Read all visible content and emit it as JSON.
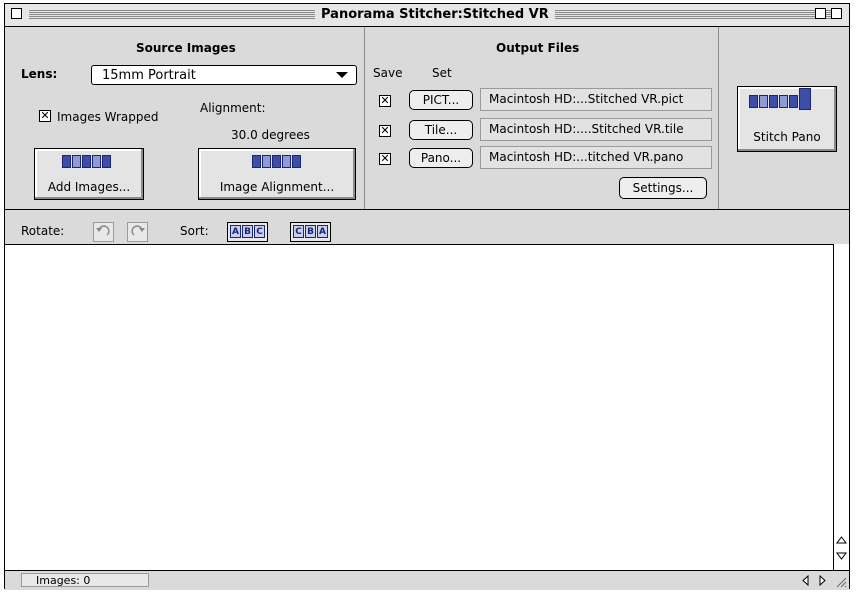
{
  "window": {
    "title": "Panorama Stitcher:Stitched VR"
  },
  "source_images": {
    "heading": "Source Images",
    "lens_label": "Lens:",
    "lens_value": "15mm Portrait",
    "images_wrapped_label": "Images Wrapped",
    "images_wrapped_checked": true,
    "alignment_label": "Alignment:",
    "alignment_value": "30.0 degrees",
    "add_images_label": "Add Images...",
    "image_alignment_label": "Image Alignment..."
  },
  "output_files": {
    "heading": "Output Files",
    "save_header": "Save",
    "set_header": "Set",
    "rows": [
      {
        "button": "PICT...",
        "path": "Macintosh HD:...Stitched VR.pict",
        "checked": true
      },
      {
        "button": "Tile...",
        "path": "Macintosh HD:....Stitched VR.tile",
        "checked": true
      },
      {
        "button": "Pano...",
        "path": "Macintosh HD:...titched VR.pano",
        "checked": true
      }
    ],
    "settings_label": "Settings..."
  },
  "stitch": {
    "label": "Stitch Pano"
  },
  "toolbar": {
    "rotate_label": "Rotate:",
    "sort_label": "Sort:",
    "sort_asc": [
      "A",
      "B",
      "C"
    ],
    "sort_desc": [
      "C",
      "B",
      "A"
    ]
  },
  "status": {
    "images_count": "Images: 0"
  },
  "colors": {
    "icon_blue": "#3d4ea8"
  }
}
